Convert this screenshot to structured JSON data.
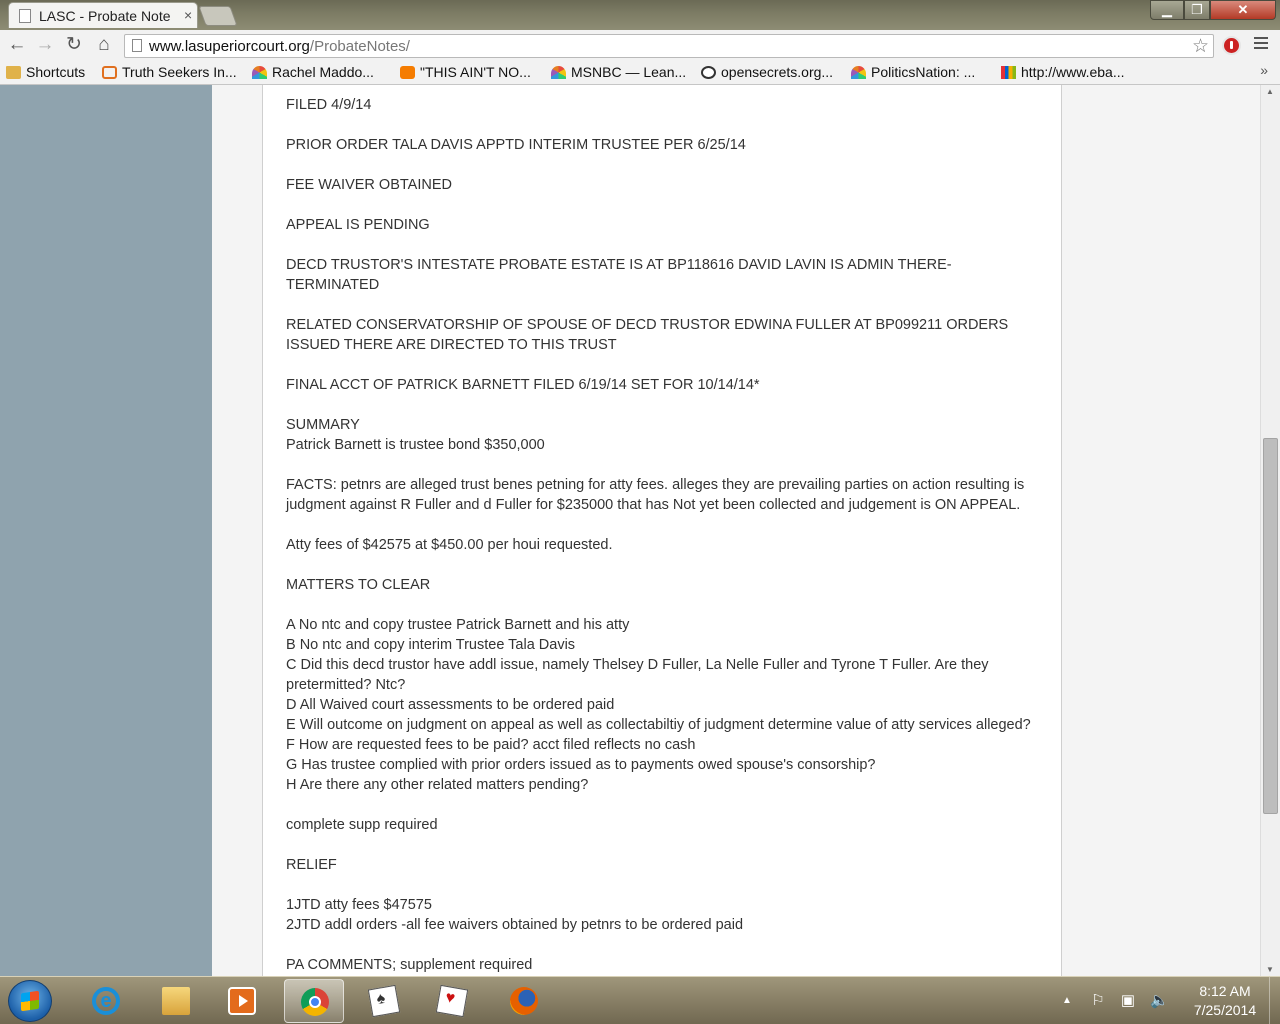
{
  "browser": {
    "tab_title": "LASC - Probate Note",
    "tab_close": "×",
    "url_host": "www.lasuperiorcourt.org",
    "url_path": "/ProbateNotes/"
  },
  "bookmarks": [
    {
      "label": "Shortcuts",
      "icon": "folder-icon"
    },
    {
      "label": "Truth Seekers In...",
      "icon": "truthseekers-icon"
    },
    {
      "label": "Rachel Maddo...",
      "icon": "nbc-peacock-icon"
    },
    {
      "label": "\"THIS AIN'T NO...",
      "icon": "blogger-icon"
    },
    {
      "label": "MSNBC — Lean...",
      "icon": "nbc-peacock-icon"
    },
    {
      "label": "opensecrets.org...",
      "icon": "eye-icon"
    },
    {
      "label": "PoliticsNation: ...",
      "icon": "nbc-peacock-icon"
    },
    {
      "label": "http://www.eba...",
      "icon": "ebay-icon"
    }
  ],
  "notes": {
    "filed": "FILED 4/9/14",
    "prior_order": "PRIOR ORDER TALA DAVIS APPTD INTERIM TRUSTEE PER 6/25/14",
    "fee_waiver": "FEE WAIVER OBTAINED",
    "appeal": "APPEAL IS PENDING",
    "decd_trustor": "DECD TRUSTOR'S INTESTATE PROBATE ESTATE IS AT BP118616 DAVID LAVIN IS ADMIN THERE- TERMINATED",
    "related": "RELATED CONSERVATORSHIP OF SPOUSE OF DECD TRUSTOR EDWINA FULLER AT BP099211 ORDERS ISSUED THERE ARE DIRECTED TO THIS TRUST",
    "final_acct": "FINAL ACCT OF PATRICK BARNETT FILED 6/19/14 SET FOR 10/14/14*",
    "summary_heading": "SUMMARY",
    "summary_text": "Patrick Barnett is trustee bond $350,000",
    "facts": "FACTS: petnrs are alleged trust benes petning for atty fees. alleges they are prevailing parties on action resulting is judgment against R Fuller and d Fuller for $235000 that has Not yet been collected and judgement is ON APPEAL.",
    "atty_fees": "Atty fees of $42575 at $450.00 per houi requested.",
    "matters_heading": "MATTERS TO CLEAR",
    "matters": [
      "A No ntc and copy trustee Patrick Barnett and his atty",
      "B No ntc and copy interim Trustee Tala Davis",
      "C Did this decd trustor have addl issue, namely Thelsey D Fuller, La Nelle Fuller and Tyrone T Fuller. Are they pretermitted? Ntc?",
      "D All Waived court assessments to be ordered paid",
      "E Will outcome on judgment on appeal as well as collectabiltiy of judgment determine value of atty services alleged?",
      "F How are requested fees to be paid? acct filed reflects no cash",
      "G Has trustee complied with prior orders issued as to payments owed spouse's consorship?",
      "H Are there any other related matters pending?"
    ],
    "supp": "complete supp required",
    "relief_heading": "RELIEF",
    "relief": [
      "1JTD atty fees $47575",
      "2JTD addl orders -all fee waivers obtained by petnrs to be ordered paid"
    ],
    "pa_comments": "PA COMMENTS; supplement required"
  },
  "taskbar": {
    "apps": [
      "ie-icon",
      "explorer-icon",
      "media-center-icon",
      "chrome-icon",
      "solitaire-icon",
      "hearts-icon",
      "firefox-icon"
    ],
    "time": "8:12 AM",
    "date": "7/25/2014"
  }
}
